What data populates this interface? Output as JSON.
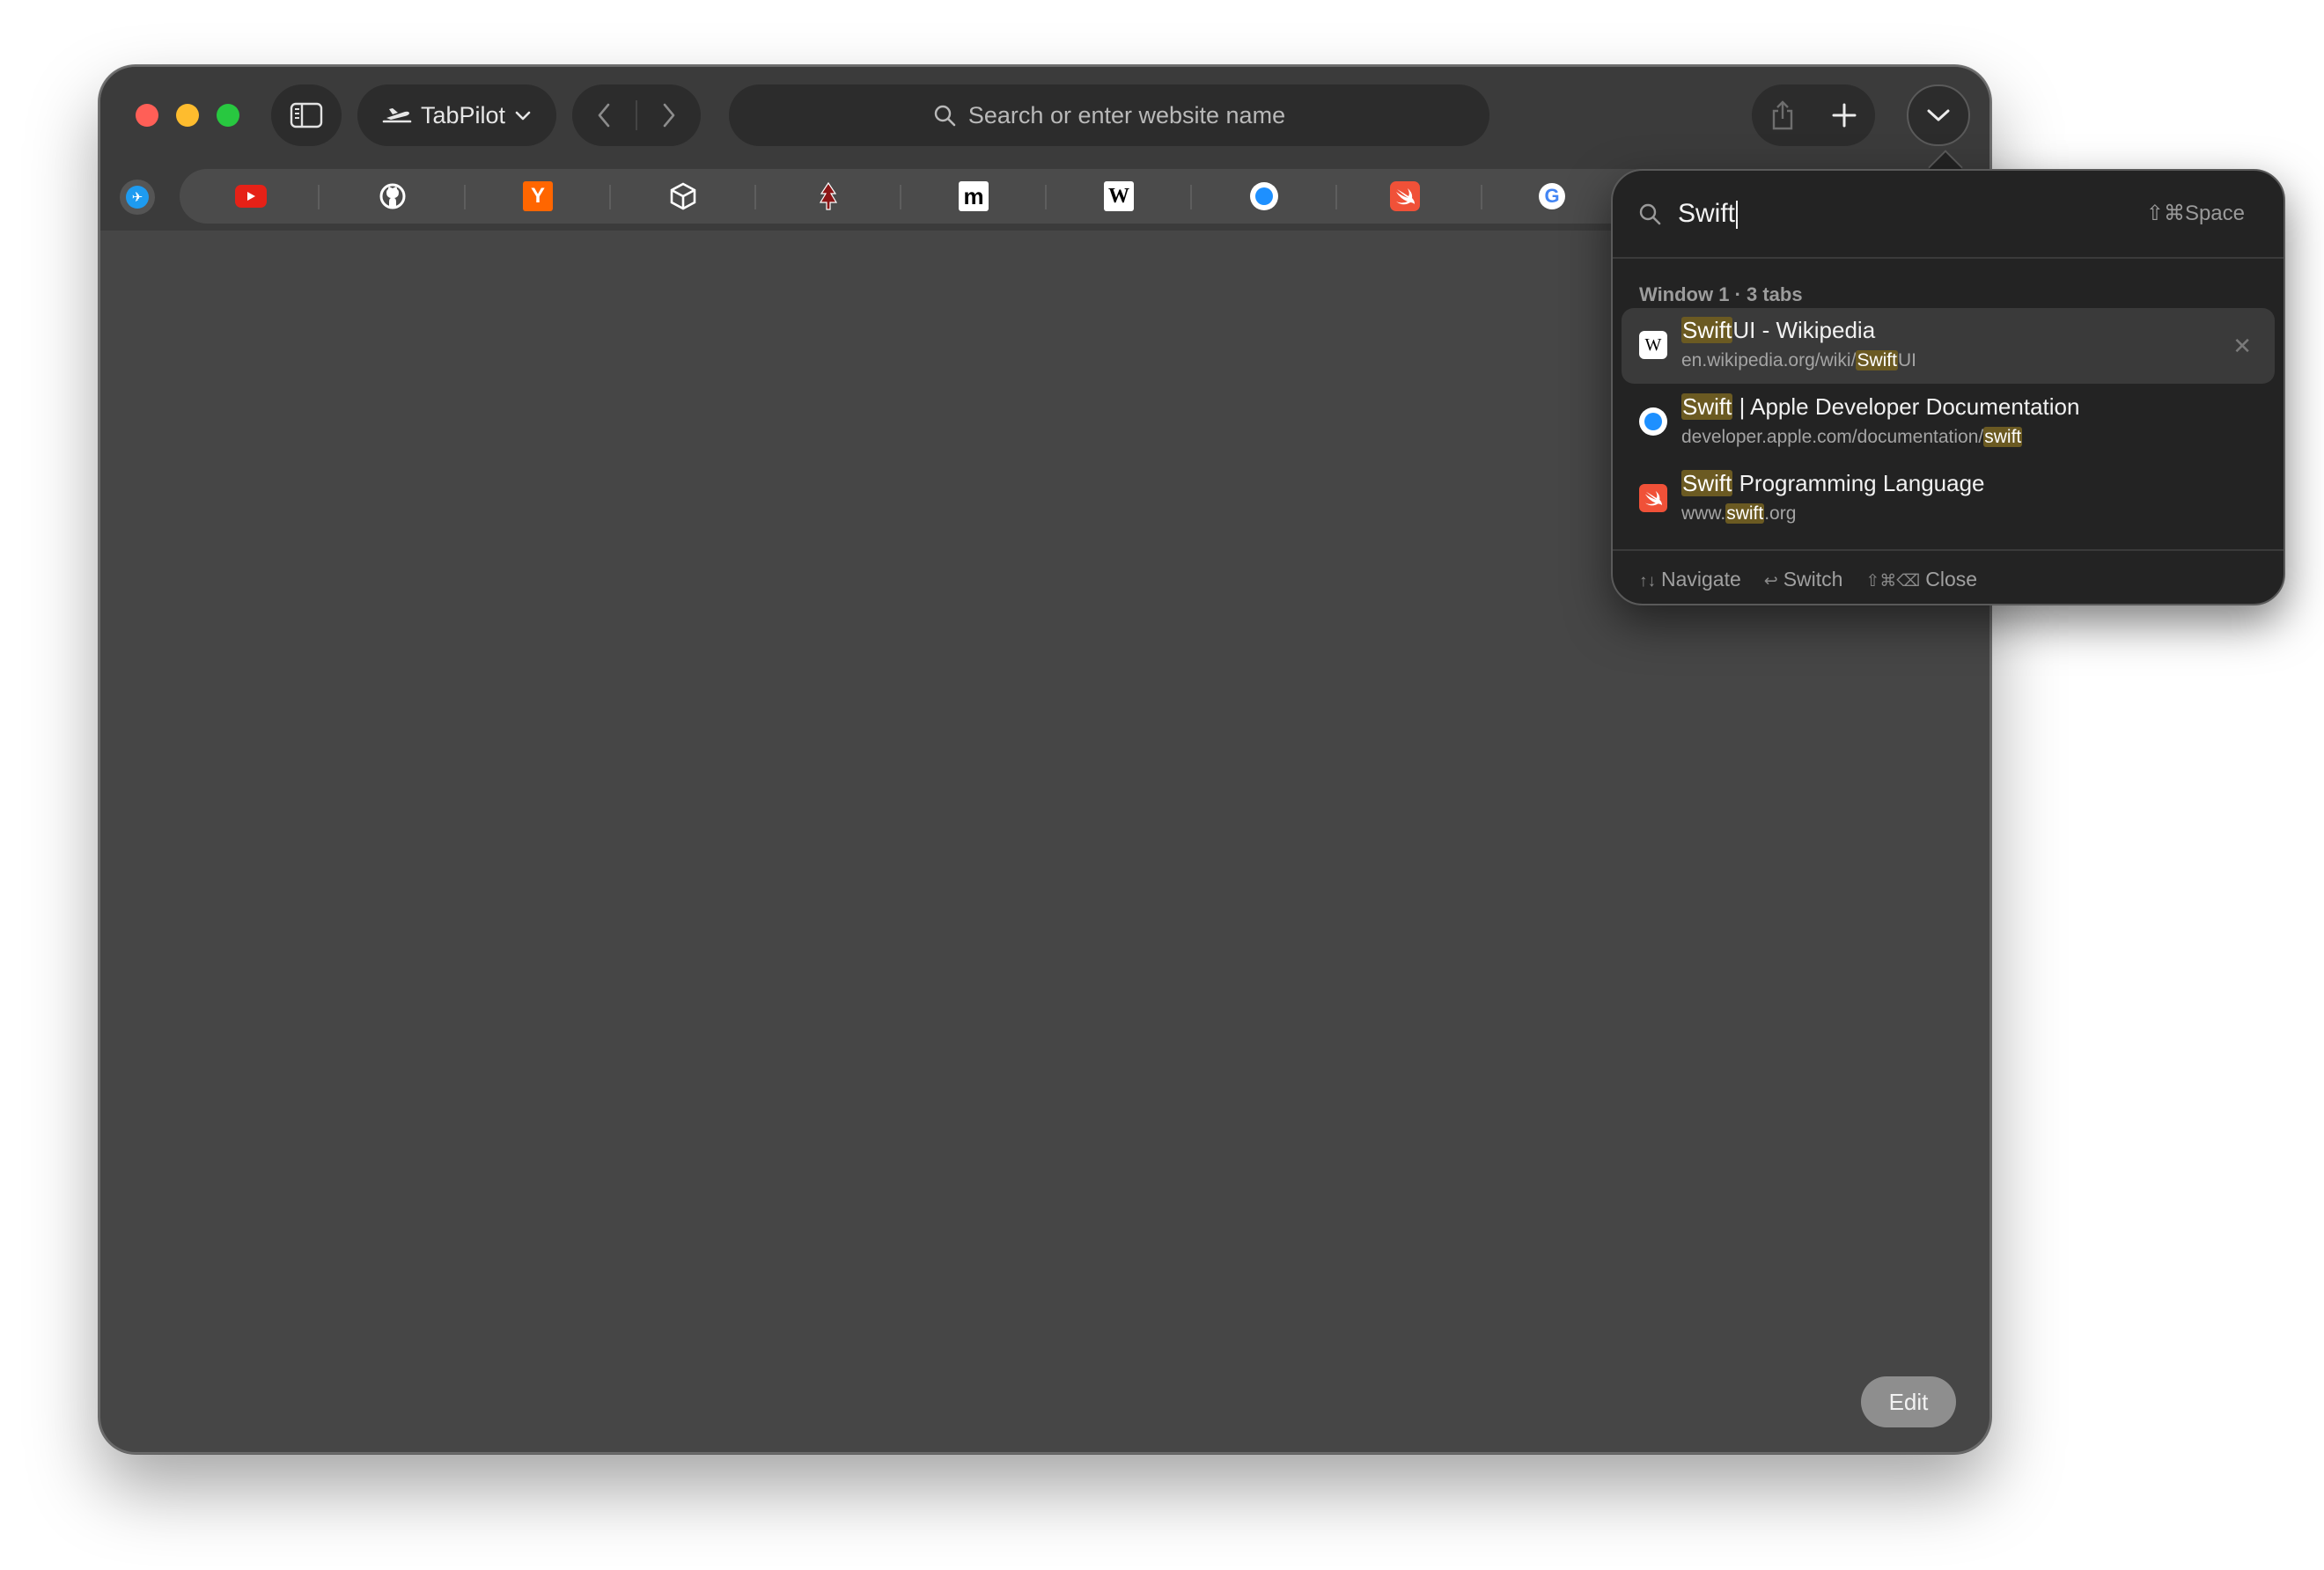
{
  "toolbar": {
    "profile_label": "TabPilot",
    "address_placeholder": "Search or enter website name"
  },
  "favorites": [
    {
      "name": "YouTube",
      "glyph": "▶",
      "color": "#e62117"
    },
    {
      "name": "GitHub",
      "glyph": "",
      "color": "#ffffff"
    },
    {
      "name": "Hacker News",
      "glyph": "Y",
      "color": "#ff6600"
    },
    {
      "name": "CodeSandbox",
      "glyph": "",
      "color": "#ffffff"
    },
    {
      "name": "Stanford",
      "glyph": "",
      "color": "#8c1515"
    },
    {
      "name": "Medium",
      "glyph": "m",
      "color": "#ffffff"
    },
    {
      "name": "Wikipedia",
      "glyph": "W",
      "color": "#ffffff"
    },
    {
      "name": "Apple Developer",
      "glyph": "",
      "color": "#1e90ff"
    },
    {
      "name": "Swift",
      "glyph": "",
      "color": "#f05138"
    },
    {
      "name": "Google",
      "glyph": "G",
      "color": "#4285f4"
    }
  ],
  "popup": {
    "query": "Swift",
    "shortcut": "⇧⌘Space",
    "group_title": "Window 1 · 3 tabs",
    "results": [
      {
        "title_hl": "Swift",
        "title_rest": "UI - Wikipedia",
        "url_pre": "en.wikipedia.org/wiki/",
        "url_hl": "Swift",
        "url_post": "UI",
        "icon": "wikipedia-icon"
      },
      {
        "title_hl": "Swift",
        "title_rest": " | Apple Developer Documentation",
        "url_pre": "developer.apple.com/documentation/",
        "url_hl": "swift",
        "url_post": "",
        "icon": "apple-developer-icon"
      },
      {
        "title_hl": "Swift",
        "title_rest": " Programming Language",
        "url_pre": "www.",
        "url_hl": "swift",
        "url_post": ".org",
        "icon": "swift-icon"
      }
    ],
    "footer": {
      "navigate_glyph": "↑↓",
      "navigate": "Navigate",
      "switch_glyph": "↩",
      "switch": "Switch",
      "close_glyph": "⇧⌘⌫",
      "close": "Close"
    }
  },
  "edit_label": "Edit",
  "colors": {
    "window_bg": "#464646",
    "toolbar_bg": "#3b3b3b",
    "highlight": "#6b5a22"
  }
}
